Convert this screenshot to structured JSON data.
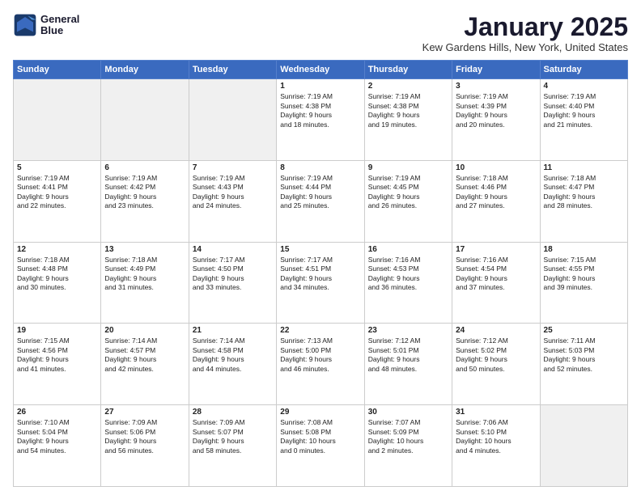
{
  "header": {
    "logo_line1": "General",
    "logo_line2": "Blue",
    "title": "January 2025",
    "subtitle": "Kew Gardens Hills, New York, United States"
  },
  "weekdays": [
    "Sunday",
    "Monday",
    "Tuesday",
    "Wednesday",
    "Thursday",
    "Friday",
    "Saturday"
  ],
  "weeks": [
    [
      {
        "day": "",
        "text": "",
        "empty": true
      },
      {
        "day": "",
        "text": "",
        "empty": true
      },
      {
        "day": "",
        "text": "",
        "empty": true
      },
      {
        "day": "1",
        "text": "Sunrise: 7:19 AM\nSunset: 4:38 PM\nDaylight: 9 hours\nand 18 minutes.",
        "empty": false
      },
      {
        "day": "2",
        "text": "Sunrise: 7:19 AM\nSunset: 4:38 PM\nDaylight: 9 hours\nand 19 minutes.",
        "empty": false
      },
      {
        "day": "3",
        "text": "Sunrise: 7:19 AM\nSunset: 4:39 PM\nDaylight: 9 hours\nand 20 minutes.",
        "empty": false
      },
      {
        "day": "4",
        "text": "Sunrise: 7:19 AM\nSunset: 4:40 PM\nDaylight: 9 hours\nand 21 minutes.",
        "empty": false
      }
    ],
    [
      {
        "day": "5",
        "text": "Sunrise: 7:19 AM\nSunset: 4:41 PM\nDaylight: 9 hours\nand 22 minutes.",
        "empty": false
      },
      {
        "day": "6",
        "text": "Sunrise: 7:19 AM\nSunset: 4:42 PM\nDaylight: 9 hours\nand 23 minutes.",
        "empty": false
      },
      {
        "day": "7",
        "text": "Sunrise: 7:19 AM\nSunset: 4:43 PM\nDaylight: 9 hours\nand 24 minutes.",
        "empty": false
      },
      {
        "day": "8",
        "text": "Sunrise: 7:19 AM\nSunset: 4:44 PM\nDaylight: 9 hours\nand 25 minutes.",
        "empty": false
      },
      {
        "day": "9",
        "text": "Sunrise: 7:19 AM\nSunset: 4:45 PM\nDaylight: 9 hours\nand 26 minutes.",
        "empty": false
      },
      {
        "day": "10",
        "text": "Sunrise: 7:18 AM\nSunset: 4:46 PM\nDaylight: 9 hours\nand 27 minutes.",
        "empty": false
      },
      {
        "day": "11",
        "text": "Sunrise: 7:18 AM\nSunset: 4:47 PM\nDaylight: 9 hours\nand 28 minutes.",
        "empty": false
      }
    ],
    [
      {
        "day": "12",
        "text": "Sunrise: 7:18 AM\nSunset: 4:48 PM\nDaylight: 9 hours\nand 30 minutes.",
        "empty": false
      },
      {
        "day": "13",
        "text": "Sunrise: 7:18 AM\nSunset: 4:49 PM\nDaylight: 9 hours\nand 31 minutes.",
        "empty": false
      },
      {
        "day": "14",
        "text": "Sunrise: 7:17 AM\nSunset: 4:50 PM\nDaylight: 9 hours\nand 33 minutes.",
        "empty": false
      },
      {
        "day": "15",
        "text": "Sunrise: 7:17 AM\nSunset: 4:51 PM\nDaylight: 9 hours\nand 34 minutes.",
        "empty": false
      },
      {
        "day": "16",
        "text": "Sunrise: 7:16 AM\nSunset: 4:53 PM\nDaylight: 9 hours\nand 36 minutes.",
        "empty": false
      },
      {
        "day": "17",
        "text": "Sunrise: 7:16 AM\nSunset: 4:54 PM\nDaylight: 9 hours\nand 37 minutes.",
        "empty": false
      },
      {
        "day": "18",
        "text": "Sunrise: 7:15 AM\nSunset: 4:55 PM\nDaylight: 9 hours\nand 39 minutes.",
        "empty": false
      }
    ],
    [
      {
        "day": "19",
        "text": "Sunrise: 7:15 AM\nSunset: 4:56 PM\nDaylight: 9 hours\nand 41 minutes.",
        "empty": false
      },
      {
        "day": "20",
        "text": "Sunrise: 7:14 AM\nSunset: 4:57 PM\nDaylight: 9 hours\nand 42 minutes.",
        "empty": false
      },
      {
        "day": "21",
        "text": "Sunrise: 7:14 AM\nSunset: 4:58 PM\nDaylight: 9 hours\nand 44 minutes.",
        "empty": false
      },
      {
        "day": "22",
        "text": "Sunrise: 7:13 AM\nSunset: 5:00 PM\nDaylight: 9 hours\nand 46 minutes.",
        "empty": false
      },
      {
        "day": "23",
        "text": "Sunrise: 7:12 AM\nSunset: 5:01 PM\nDaylight: 9 hours\nand 48 minutes.",
        "empty": false
      },
      {
        "day": "24",
        "text": "Sunrise: 7:12 AM\nSunset: 5:02 PM\nDaylight: 9 hours\nand 50 minutes.",
        "empty": false
      },
      {
        "day": "25",
        "text": "Sunrise: 7:11 AM\nSunset: 5:03 PM\nDaylight: 9 hours\nand 52 minutes.",
        "empty": false
      }
    ],
    [
      {
        "day": "26",
        "text": "Sunrise: 7:10 AM\nSunset: 5:04 PM\nDaylight: 9 hours\nand 54 minutes.",
        "empty": false
      },
      {
        "day": "27",
        "text": "Sunrise: 7:09 AM\nSunset: 5:06 PM\nDaylight: 9 hours\nand 56 minutes.",
        "empty": false
      },
      {
        "day": "28",
        "text": "Sunrise: 7:09 AM\nSunset: 5:07 PM\nDaylight: 9 hours\nand 58 minutes.",
        "empty": false
      },
      {
        "day": "29",
        "text": "Sunrise: 7:08 AM\nSunset: 5:08 PM\nDaylight: 10 hours\nand 0 minutes.",
        "empty": false
      },
      {
        "day": "30",
        "text": "Sunrise: 7:07 AM\nSunset: 5:09 PM\nDaylight: 10 hours\nand 2 minutes.",
        "empty": false
      },
      {
        "day": "31",
        "text": "Sunrise: 7:06 AM\nSunset: 5:10 PM\nDaylight: 10 hours\nand 4 minutes.",
        "empty": false
      },
      {
        "day": "",
        "text": "",
        "empty": true
      }
    ]
  ]
}
